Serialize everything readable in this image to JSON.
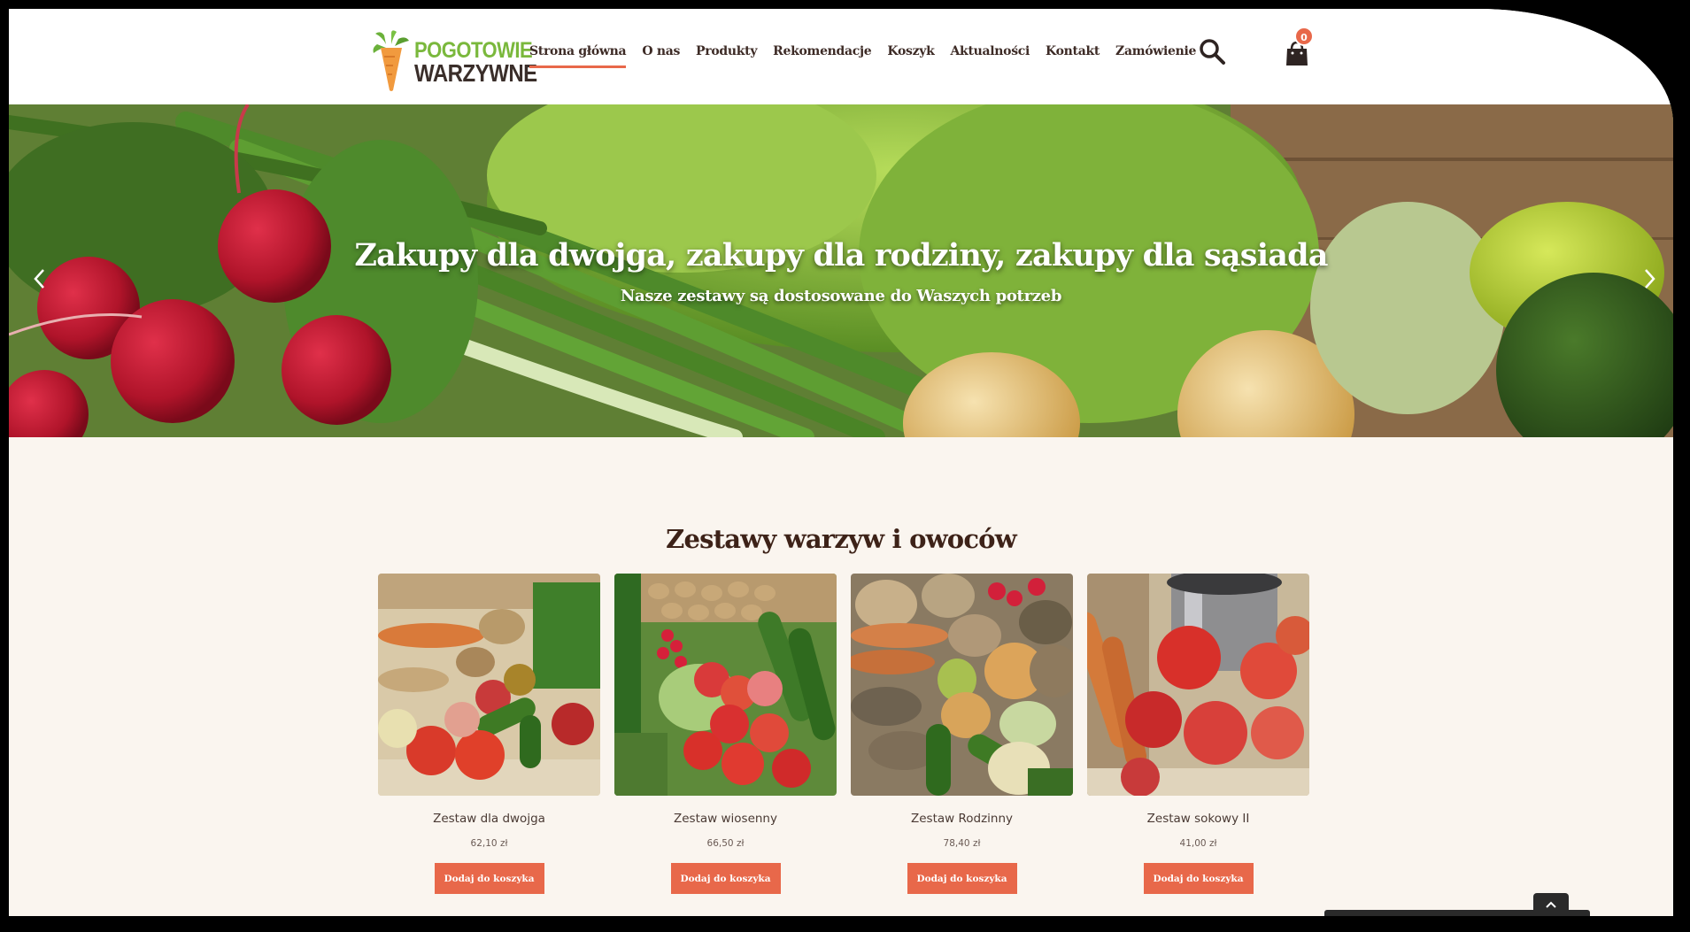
{
  "logo": {
    "line1": "POGOTOWIE",
    "line2": "WARZYWNE"
  },
  "nav": {
    "items": [
      {
        "label": "Strona główna",
        "active": true
      },
      {
        "label": "O nas"
      },
      {
        "label": "Produkty"
      },
      {
        "label": "Rekomendacje"
      },
      {
        "label": "Koszyk"
      },
      {
        "label": "Aktualności"
      },
      {
        "label": "Kontakt"
      },
      {
        "label": "Zamówienie"
      }
    ]
  },
  "icons": {
    "search": "search-icon",
    "cart": "shopping-bag-icon",
    "arrow_left": "chevron-left-icon",
    "arrow_right": "chevron-right-icon",
    "scroll_top": "chevron-up-icon"
  },
  "cart": {
    "count": "0"
  },
  "hero": {
    "title": "Zakupy dla dwojga, zakupy dla rodziny, zakupy dla sąsiada",
    "subtitle": "Nasze zestawy są dostosowane do Waszych potrzeb"
  },
  "section": {
    "title": "Zestawy warzyw i owoców"
  },
  "products": [
    {
      "name": "Zestaw dla dwojga",
      "price": "62,10 zł",
      "button": "Dodaj do koszyka"
    },
    {
      "name": "Zestaw wiosenny",
      "price": "66,50 zł",
      "button": "Dodaj do koszyka"
    },
    {
      "name": "Zestaw Rodzinny",
      "price": "78,40 zł",
      "button": "Dodaj do koszyka"
    },
    {
      "name": "Zestaw sokowy II",
      "price": "41,00 zł",
      "button": "Dodaj do koszyka"
    }
  ],
  "colors": {
    "accent": "#e8684a",
    "logo_green": "#7ab83c",
    "text_dark": "#3d2b26",
    "background": "#faf5ef"
  }
}
